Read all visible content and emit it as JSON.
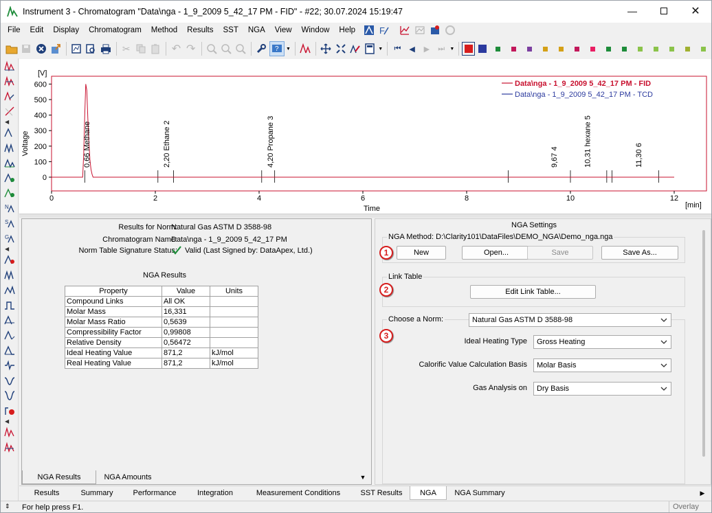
{
  "window": {
    "title": "Instrument 3 - Chromatogram \"Data\\nga - 1_9_2009 5_42_17 PM - FID\" - #22;   30.07.2024    15:19:47"
  },
  "menu": [
    "File",
    "Edit",
    "Display",
    "Chromatogram",
    "Method",
    "Results",
    "SST",
    "NGA",
    "View",
    "Window",
    "Help"
  ],
  "colors": {
    "accent_red": "#d71d1d",
    "trace_fid": "#c8102e",
    "trace_tcd": "#2b3a9e"
  },
  "toolbar": {
    "color_squares": [
      "#1e8c3a",
      "#c2185b",
      "#7b3fa0",
      "#d4a017",
      "#d4a017",
      "#c2185b",
      "#e91e63",
      "#1e8c3a",
      "#1e8c3a",
      "#8bc34a",
      "#8bc34a",
      "#8bc34a",
      "#a0b030",
      "#8bc34a"
    ]
  },
  "chart_data": {
    "type": "line",
    "ylabel": "Voltage",
    "yunit": "[V]",
    "xlabel": "Time",
    "xunit": "[min]",
    "xlim": [
      0,
      12
    ],
    "ylim": [
      -30,
      620
    ],
    "x_ticks": [
      "0",
      "2",
      "4",
      "6",
      "8",
      "10",
      "12"
    ],
    "y_ticks": [
      "0",
      "100",
      "200",
      "300",
      "400",
      "500",
      "600"
    ],
    "series": [
      {
        "name": "Data\\nga - 1_9_2009 5_42_17 PM - FID",
        "color": "#c8102e",
        "x": [
          0,
          0.6,
          0.62,
          0.64,
          0.66,
          0.68,
          0.7,
          0.72,
          0.74,
          0.76,
          0.78,
          0.8,
          2.2,
          4.2,
          9.67,
          10.31,
          11.3,
          12
        ],
        "y": [
          0,
          0,
          150,
          400,
          600,
          560,
          380,
          220,
          110,
          50,
          20,
          0,
          0,
          0,
          0,
          0,
          0,
          0
        ]
      },
      {
        "name": "Data\\nga - 1_9_2009 5_42_17 PM - TCD",
        "color": "#2b3a9e",
        "x": [],
        "y": []
      }
    ],
    "peaks": [
      {
        "x": 0.66,
        "label": "0,66 Methane"
      },
      {
        "x": 2.2,
        "label": "2,20 Ethane  2"
      },
      {
        "x": 4.2,
        "label": "4,20 Propane  3"
      },
      {
        "x": 9.67,
        "label": "9,67    4"
      },
      {
        "x": 10.31,
        "label": "10,31 hexane  5"
      },
      {
        "x": 11.3,
        "label": "11,30   6"
      }
    ],
    "marks": [
      0.64,
      2.05,
      2.35,
      4.05,
      4.3,
      8.8,
      10.0,
      10.7,
      10.8,
      11.7
    ],
    "legend_position": "top-right"
  },
  "results": {
    "norm_label": "Results for Norm:",
    "norm_value": "Natural Gas ASTM D 3588-98",
    "chrom_label": "Chromatogram Name:",
    "chrom_value": "Data\\nga - 1_9_2009 5_42_17 PM",
    "sig_label": "Norm Table Signature Status:",
    "sig_value": "Valid (Last Signed by: DataApex, Ltd.)",
    "section_title": "NGA Results",
    "columns": [
      "Property",
      "Value",
      "Units"
    ],
    "rows": [
      [
        "Compound Links",
        "All OK",
        ""
      ],
      [
        "Molar Mass",
        "16,331",
        ""
      ],
      [
        "Molar Mass Ratio",
        "0,5639",
        ""
      ],
      [
        "Compressibility Factor",
        "0,99808",
        ""
      ],
      [
        "Relative Density",
        "0,56472",
        ""
      ],
      [
        "Ideal Heating Value",
        "871,2",
        "kJ/mol"
      ],
      [
        "Real Heating Value",
        "871,2",
        "kJ/mol"
      ]
    ],
    "subtabs": [
      "NGA Results",
      "NGA Amounts"
    ]
  },
  "settings": {
    "title": "NGA Settings",
    "method_label": "NGA Method: D:\\Clarity101\\DataFiles\\DEMO_NGA\\Demo_nga.nga",
    "buttons": {
      "new": "New",
      "open": "Open...",
      "save": "Save",
      "save_as": "Save As..."
    },
    "link_table_label": "Link Table",
    "edit_link_table": "Edit Link Table...",
    "norm_label": "Choose a Norm:",
    "norm_value": "Natural Gas ASTM D 3588-98",
    "ideal_label": "Ideal Heating Type",
    "ideal_value": "Gross Heating",
    "calorific_label": "Calorific Value Calculation Basis",
    "calorific_value": "Molar Basis",
    "gas_label": "Gas Analysis on",
    "gas_value": "Dry Basis",
    "badges": [
      "1",
      "2",
      "3"
    ]
  },
  "tabs": [
    "Results",
    "Summary",
    "Performance",
    "Integration",
    "Measurement Conditions",
    "SST Results",
    "NGA",
    "NGA Summary"
  ],
  "active_tab": "NGA",
  "status": {
    "help": "For help press F1.",
    "overlay": "Overlay"
  }
}
